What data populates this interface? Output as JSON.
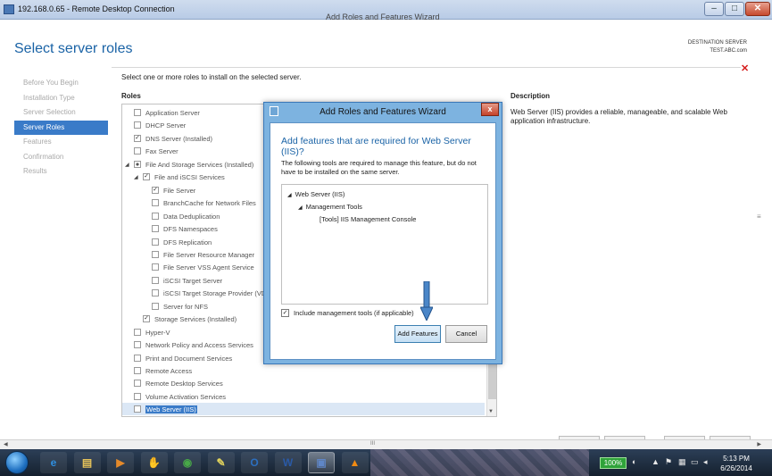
{
  "window": {
    "title": "192.168.0.65 - Remote Desktop Connection",
    "subtitle": "Add Roles and Features Wizard",
    "min_icon": "minimize-icon",
    "max_icon": "maximize-icon",
    "close_icon": "close-icon"
  },
  "page": {
    "title": "Select server roles",
    "destination_label": "DESTINATION SERVER",
    "destination_server": "TEST.ABC.com",
    "close_glyph": "✕",
    "instruction": "Select one or more roles to install on the selected server.",
    "roles_header": "Roles",
    "description_header": "Description",
    "description_text": "Web Server (IIS) provides a reliable, manageable, and scalable Web application infrastructure."
  },
  "nav": {
    "items": [
      {
        "label": "Before You Begin",
        "active": false
      },
      {
        "label": "Installation Type",
        "active": false
      },
      {
        "label": "Server Selection",
        "active": false
      },
      {
        "label": "Server Roles",
        "active": true
      },
      {
        "label": "Features",
        "active": false
      },
      {
        "label": "Confirmation",
        "active": false
      },
      {
        "label": "Results",
        "active": false
      }
    ]
  },
  "roles": [
    {
      "label": "Application Server",
      "level": 0,
      "checked": false,
      "expander": ""
    },
    {
      "label": "DHCP Server",
      "level": 0,
      "checked": false,
      "expander": ""
    },
    {
      "label": "DNS Server (Installed)",
      "level": 0,
      "checked": true,
      "expander": ""
    },
    {
      "label": "Fax Server",
      "level": 0,
      "checked": false,
      "expander": ""
    },
    {
      "label": "File And Storage Services (Installed)",
      "level": 0,
      "checked": "partial",
      "expander": "◢"
    },
    {
      "label": "File and iSCSI Services",
      "level": 1,
      "checked": true,
      "expander": "◢"
    },
    {
      "label": "File Server",
      "level": 2,
      "checked": true,
      "expander": ""
    },
    {
      "label": "BranchCache for Network Files",
      "level": 2,
      "checked": false,
      "expander": ""
    },
    {
      "label": "Data Deduplication",
      "level": 2,
      "checked": false,
      "expander": ""
    },
    {
      "label": "DFS Namespaces",
      "level": 2,
      "checked": false,
      "expander": ""
    },
    {
      "label": "DFS Replication",
      "level": 2,
      "checked": false,
      "expander": ""
    },
    {
      "label": "File Server Resource Manager",
      "level": 2,
      "checked": false,
      "expander": ""
    },
    {
      "label": "File Server VSS Agent Service",
      "level": 2,
      "checked": false,
      "expander": ""
    },
    {
      "label": "iSCSI Target Server",
      "level": 2,
      "checked": false,
      "expander": ""
    },
    {
      "label": "iSCSI Target Storage Provider (VD",
      "level": 2,
      "checked": false,
      "expander": ""
    },
    {
      "label": "Server for NFS",
      "level": 2,
      "checked": false,
      "expander": ""
    },
    {
      "label": "Storage Services (Installed)",
      "level": 1,
      "checked": true,
      "expander": ""
    },
    {
      "label": "Hyper-V",
      "level": 0,
      "checked": false,
      "expander": ""
    },
    {
      "label": "Network Policy and Access Services",
      "level": 0,
      "checked": false,
      "expander": ""
    },
    {
      "label": "Print and Document Services",
      "level": 0,
      "checked": false,
      "expander": ""
    },
    {
      "label": "Remote Access",
      "level": 0,
      "checked": false,
      "expander": ""
    },
    {
      "label": "Remote Desktop Services",
      "level": 0,
      "checked": false,
      "expander": ""
    },
    {
      "label": "Volume Activation Services",
      "level": 0,
      "checked": false,
      "expander": ""
    },
    {
      "label": "Web Server (IIS)",
      "level": 0,
      "checked": false,
      "expander": "",
      "selected": true
    }
  ],
  "dialog": {
    "title": "Add Roles and Features Wizard",
    "close_glyph": "x",
    "heading": "Add features that are required for Web Server (IIS)?",
    "text": "The following tools are required to manage this feature, but do not have to be installed on the same server.",
    "tree": [
      {
        "label": "Web Server (IIS)",
        "level": 0,
        "expander": "◢"
      },
      {
        "label": "Management Tools",
        "level": 1,
        "expander": "◢"
      },
      {
        "label": "[Tools] IIS Management Console",
        "level": 2,
        "expander": ""
      }
    ],
    "include_label": "Include management tools (if applicable)",
    "include_checked": true,
    "add_button": "Add Features",
    "cancel_button": "Cancel"
  },
  "scrollbar": {
    "grip": "III"
  },
  "taskbar": {
    "apps": [
      {
        "name": "ie-icon",
        "glyph": "e",
        "color": "#2f8fe0",
        "active": false
      },
      {
        "name": "file-explorer-icon",
        "glyph": "▤",
        "color": "#e6c35a",
        "active": false
      },
      {
        "name": "media-player-icon",
        "glyph": "▶",
        "color": "#e58a2a",
        "active": false
      },
      {
        "name": "red-app-icon",
        "glyph": "✋",
        "color": "#d33a2c",
        "active": false
      },
      {
        "name": "chrome-icon",
        "glyph": "◉",
        "color": "#48a848",
        "active": false
      },
      {
        "name": "notes-icon",
        "glyph": "✎",
        "color": "#e2d35c",
        "active": false
      },
      {
        "name": "outlook-icon",
        "glyph": "O",
        "color": "#2c6fbf",
        "active": false
      },
      {
        "name": "word-icon",
        "glyph": "W",
        "color": "#2a5aa7",
        "active": false
      },
      {
        "name": "remote-desktop-icon",
        "glyph": "▣",
        "color": "#5f86c6",
        "active": true
      },
      {
        "name": "vlc-icon",
        "glyph": "▲",
        "color": "#f08a12",
        "active": false
      }
    ],
    "battery": "100%",
    "time": "5:13 PM",
    "date": "6/26/2014"
  }
}
